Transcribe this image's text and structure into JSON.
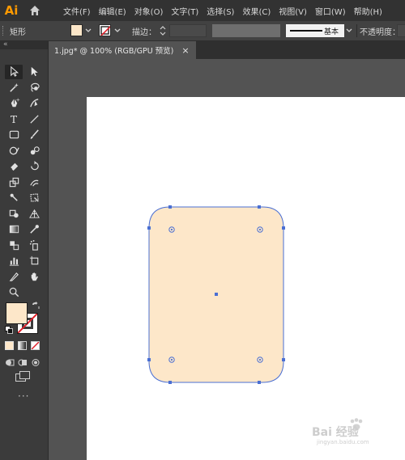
{
  "app": {
    "logo_text": "Ai"
  },
  "menu": {
    "items": [
      "文件(F)",
      "编辑(E)",
      "对象(O)",
      "文字(T)",
      "选择(S)",
      "效果(C)",
      "视图(V)",
      "窗口(W)",
      "帮助(H)"
    ]
  },
  "control_bar": {
    "object_type": "矩形",
    "fill_color": "#fde7c9",
    "stroke_color": "none",
    "stroke_label": "描边：",
    "stroke_weight": "",
    "brush_label": "基本",
    "opacity_label": "不透明度："
  },
  "document": {
    "tab_title": "1.jpg* @ 100% (RGB/GPU 预览)",
    "close_icon": "×"
  },
  "toolbar": {
    "collapse_icon": "«",
    "more_tools_label": "···",
    "fill_color": "#fde7c9",
    "stroke_color": "none"
  },
  "shape": {
    "type": "rounded-rectangle",
    "fill": "#fde7c9",
    "selection_color": "#4a6fd3"
  },
  "watermark": {
    "brand": "Bai 经验",
    "url": "jingyan.baidu.com"
  }
}
